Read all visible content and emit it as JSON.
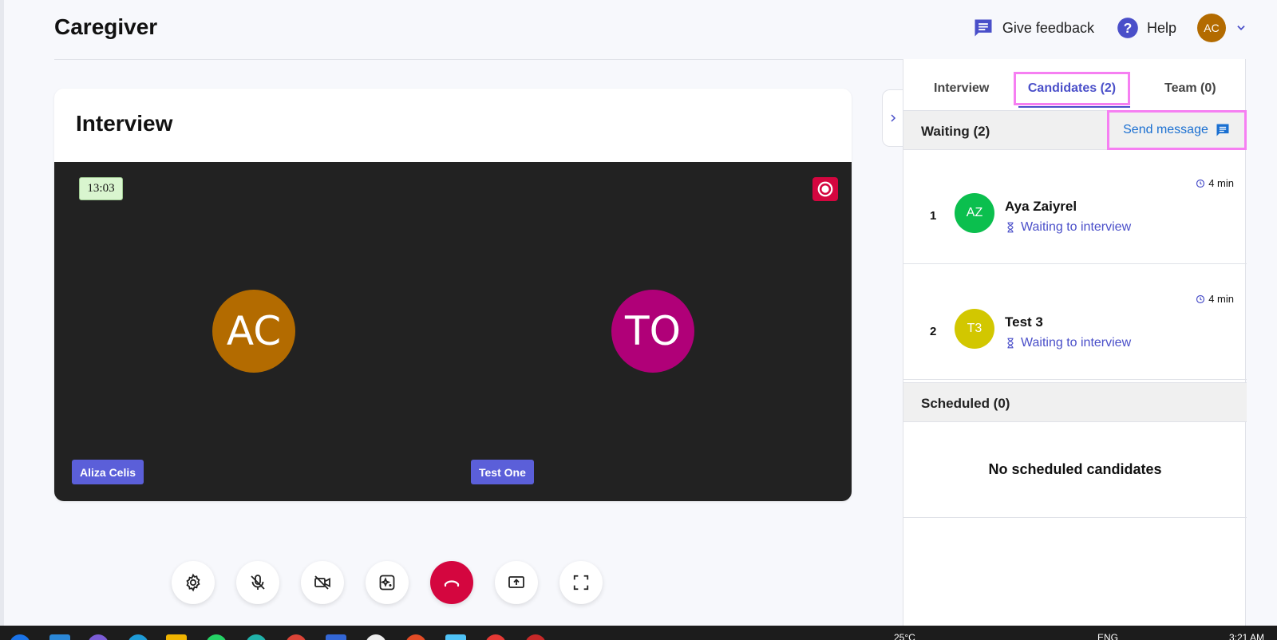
{
  "header": {
    "app_title": "Caregiver",
    "feedback_label": "Give feedback",
    "help_label": "Help",
    "user_initials": "AC"
  },
  "card": {
    "title": "Interview",
    "timer": "13:03",
    "participants": [
      {
        "initials": "AC",
        "name": "Aliza Celis",
        "color": "#b36b00"
      },
      {
        "initials": "TO",
        "name": "Test One",
        "color": "#b00078"
      }
    ]
  },
  "controls": [
    "settings-icon",
    "mic-off-icon",
    "camera-off-icon",
    "effects-icon",
    "end-call-icon",
    "share-screen-icon",
    "fullscreen-icon"
  ],
  "panel": {
    "tabs": {
      "interview": "Interview",
      "candidates": "Candidates (2)",
      "team": "Team (0)"
    },
    "waiting": {
      "title": "Waiting (2)",
      "send_message": "Send message",
      "candidates": [
        {
          "num": "1",
          "initials": "AZ",
          "name": "Aya Zaiyrel",
          "status": "Waiting to interview",
          "time": "4 min",
          "color": "#0bbf4e"
        },
        {
          "num": "2",
          "initials": "T3",
          "name": "Test 3",
          "status": "Waiting to interview",
          "time": "4 min",
          "color": "#d2c700"
        }
      ]
    },
    "scheduled": {
      "title": "Scheduled (0)",
      "empty": "No scheduled candidates"
    }
  },
  "taskbar": {
    "weather": "25°C",
    "lang": "ENG",
    "time": "3:21 AM"
  },
  "colors": {
    "accent": "#4a4fc9",
    "end_call": "#d4063f",
    "highlight": "#f67ff2",
    "link": "#1a6fd1"
  }
}
